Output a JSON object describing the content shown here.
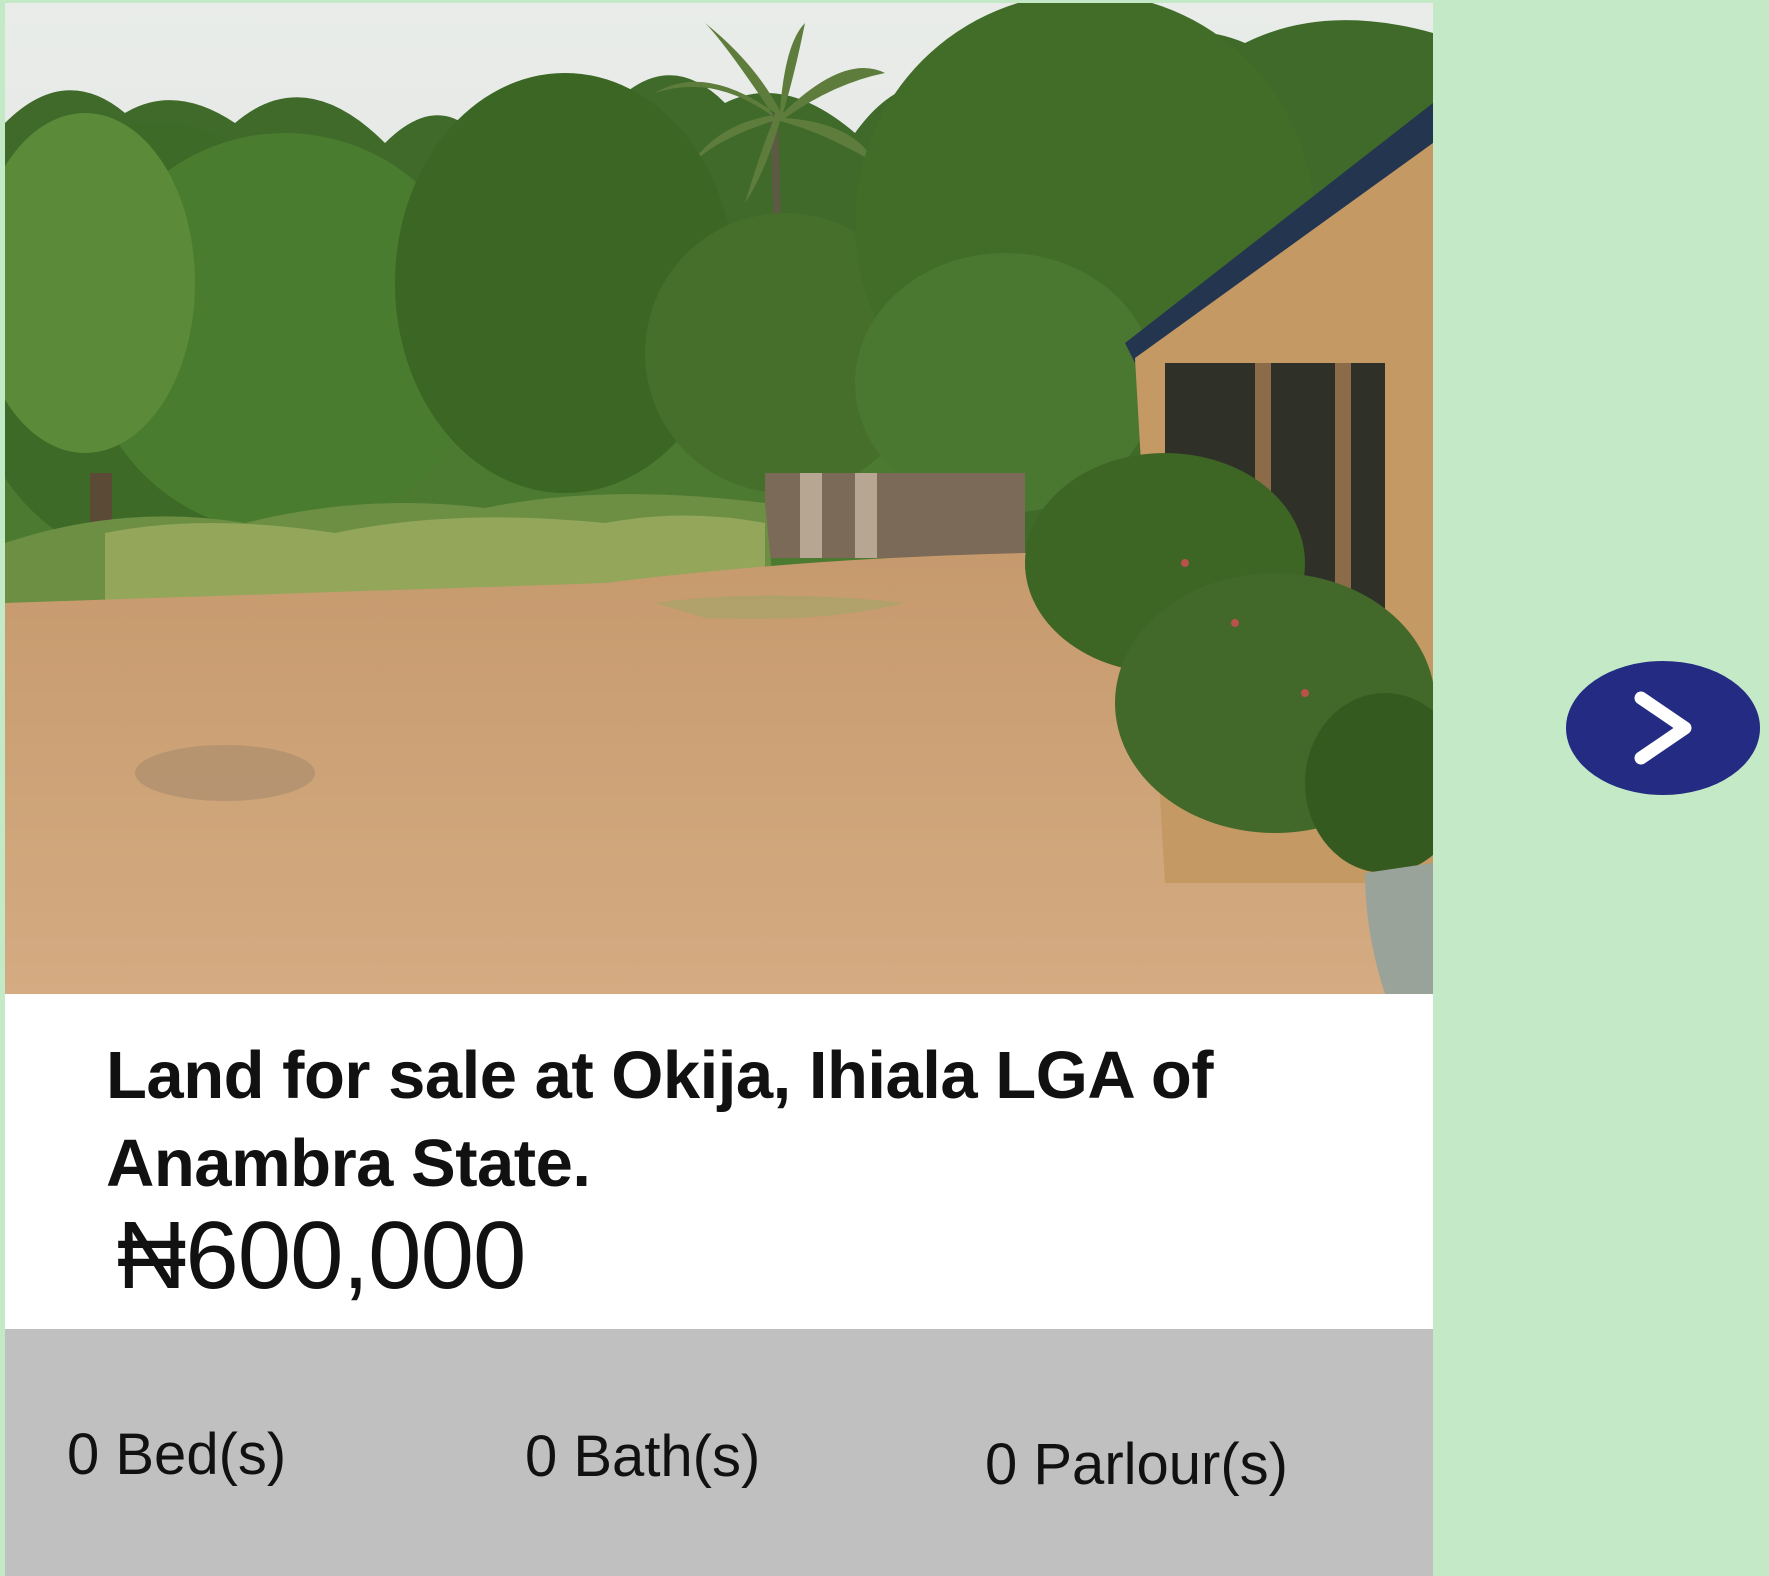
{
  "listing": {
    "photo_icon": "property-photo",
    "title": "Land for sale at Okija, Ihiala LGA of Anambra State.",
    "price": "₦600,000"
  },
  "features": {
    "beds": "0 Bed(s)",
    "baths": "0 Bath(s)",
    "parlours": "0 Parlour(s)"
  },
  "navigation": {
    "next_icon": "chevron-right-icon"
  },
  "colors": {
    "background": "#c3e9c7",
    "card": "#ffffff",
    "stats_bar": "#c0c0c0",
    "nav_button": "#242b82",
    "text": "#111111"
  }
}
